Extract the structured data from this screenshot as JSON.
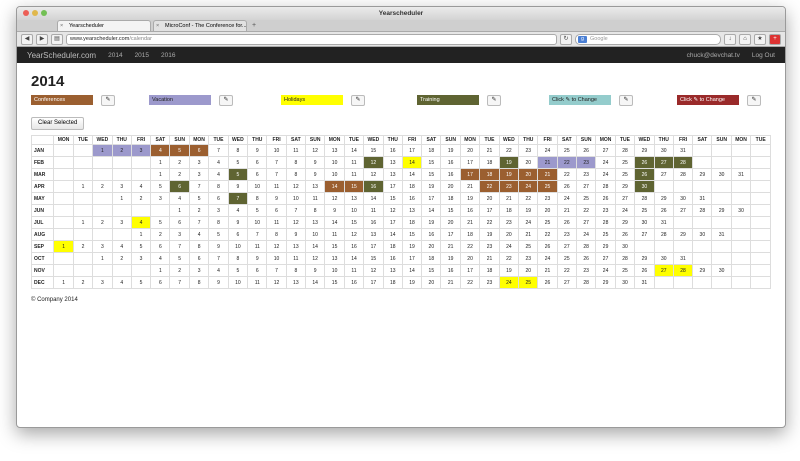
{
  "browser": {
    "window_title": "Yearscheduler",
    "tabs": [
      {
        "label": "Yearscheduler",
        "active": true
      },
      {
        "label": "MicroConf - The Conference for...",
        "active": false
      }
    ],
    "url_host": "www.yearscheduler.com",
    "url_path": "/calendar",
    "search_engine": "Google",
    "search_placeholder": "Google"
  },
  "navbar": {
    "brand": "YearScheduler.com",
    "years": [
      "2014",
      "2015",
      "2016"
    ],
    "user_email": "chuck@devchat.tv",
    "logout_label": "Log Out"
  },
  "page": {
    "year_title": "2014",
    "clear_label": "Clear Selected",
    "footer": "© Company 2014"
  },
  "legend": [
    {
      "label": "Conferences",
      "color": "#9b5f30",
      "text_color": "#ffffff"
    },
    {
      "label": "Vacation",
      "color": "#9c99cc",
      "text_color": "#222222"
    },
    {
      "label": "Holidays",
      "color": "#ffff00",
      "text_color": "#222222"
    },
    {
      "label": "Training",
      "color": "#5f6432",
      "text_color": "#ffffff"
    },
    {
      "label": "Click ✎ to Change",
      "color": "#94cccc",
      "text_color": "#222222"
    },
    {
      "label": "Click ✎ to Change",
      "color": "#9a2a2a",
      "text_color": "#ffffff"
    }
  ],
  "category_colors": {
    "C": "#9b5f30",
    "V": "#9c99cc",
    "H": "#ffff00",
    "T": "#5f6432"
  },
  "weekdays": [
    "MON",
    "TUE",
    "WED",
    "THU",
    "FRI",
    "SAT",
    "SUN",
    "MON",
    "TUE",
    "WED",
    "THU",
    "FRI",
    "SAT",
    "SUN",
    "MON",
    "TUE",
    "WED",
    "THU",
    "FRI",
    "SAT",
    "SUN",
    "MON",
    "TUE",
    "WED",
    "THU",
    "FRI",
    "SAT",
    "SUN",
    "MON",
    "TUE",
    "WED",
    "THU",
    "FRI",
    "SAT",
    "SUN",
    "MON",
    "TUE"
  ],
  "months": [
    {
      "name": "JAN",
      "offset": 2,
      "days": 31,
      "marks": {
        "1": "V",
        "2": "V",
        "3": "V",
        "4": "C",
        "5": "C",
        "6": "C"
      }
    },
    {
      "name": "FEB",
      "offset": 5,
      "days": 28,
      "marks": {
        "12": "T",
        "14": "H",
        "19": "T",
        "21": "V",
        "22": "V",
        "23": "V",
        "26": "T",
        "27": "T",
        "28": "T"
      }
    },
    {
      "name": "MAR",
      "offset": 5,
      "days": 31,
      "marks": {
        "5": "T",
        "17": "C",
        "18": "C",
        "19": "C",
        "20": "C",
        "21": "C",
        "26": "T"
      }
    },
    {
      "name": "APR",
      "offset": 1,
      "days": 30,
      "marks": {
        "6": "T",
        "14": "C",
        "15": "C",
        "16": "T",
        "22": "C",
        "23": "C",
        "24": "C",
        "25": "C",
        "30": "T"
      }
    },
    {
      "name": "MAY",
      "offset": 3,
      "days": 31,
      "marks": {
        "7": "T"
      }
    },
    {
      "name": "JUN",
      "offset": 6,
      "days": 30,
      "marks": {}
    },
    {
      "name": "JUL",
      "offset": 1,
      "days": 31,
      "marks": {
        "4": "H"
      }
    },
    {
      "name": "AUG",
      "offset": 4,
      "days": 31,
      "marks": {}
    },
    {
      "name": "SEP",
      "offset": 0,
      "days": 30,
      "marks": {
        "1": "H"
      }
    },
    {
      "name": "OCT",
      "offset": 2,
      "days": 31,
      "marks": {}
    },
    {
      "name": "NOV",
      "offset": 5,
      "days": 30,
      "marks": {
        "27": "H",
        "28": "H"
      }
    },
    {
      "name": "DEC",
      "offset": 0,
      "days": 31,
      "marks": {
        "24": "H",
        "25": "H"
      }
    }
  ]
}
